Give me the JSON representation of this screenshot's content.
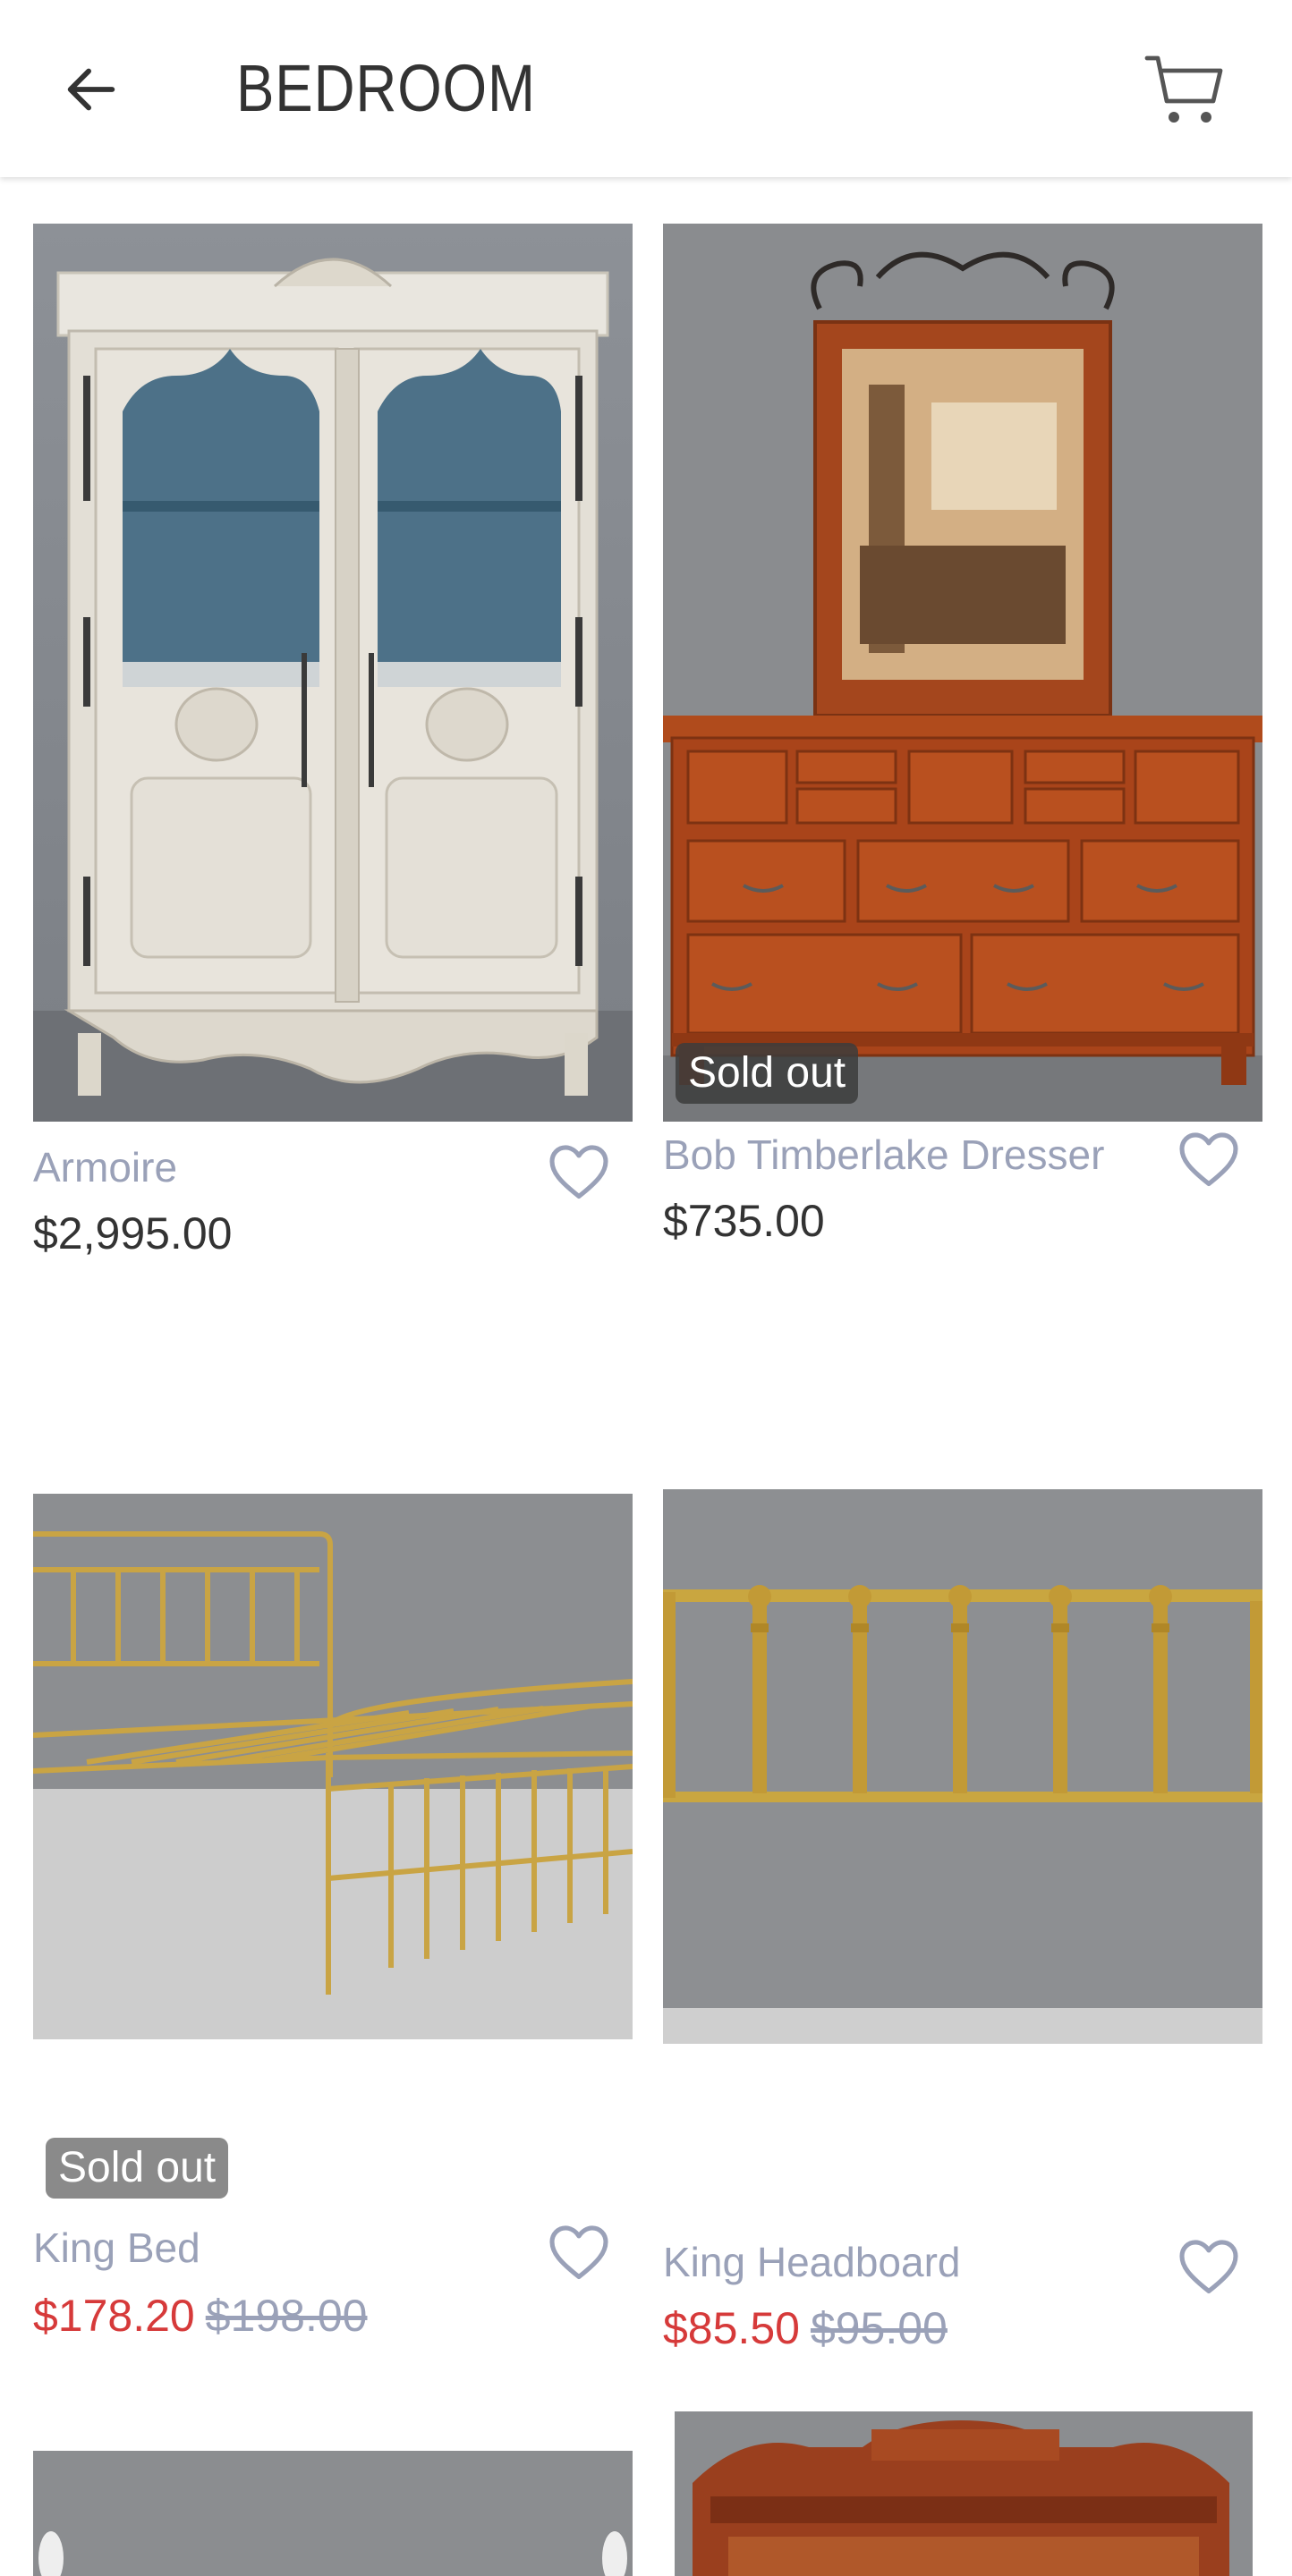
{
  "header": {
    "title": "BEDROOM",
    "back_icon": "arrow-left-icon",
    "cart_icon": "shopping-cart-icon"
  },
  "products": [
    {
      "name": "Armoire",
      "price": "$2,995.00",
      "sold_out": false
    },
    {
      "name": "Bob Timberlake Dresser",
      "price": "$735.00",
      "sold_out": true,
      "badge": "Sold out"
    },
    {
      "name": "King Bed",
      "sale_price": "$178.20",
      "original_price": "$198.00",
      "sold_out": true,
      "badge": "Sold out"
    },
    {
      "name": "King Headboard",
      "sale_price": "$85.50",
      "original_price": "$95.00",
      "sold_out": false
    }
  ],
  "icons": {
    "favorite": "heart-outline-icon"
  },
  "colors": {
    "sale": "#d63a3a",
    "product_name": "#9aa1b8",
    "badge": "#8a8a8a"
  }
}
